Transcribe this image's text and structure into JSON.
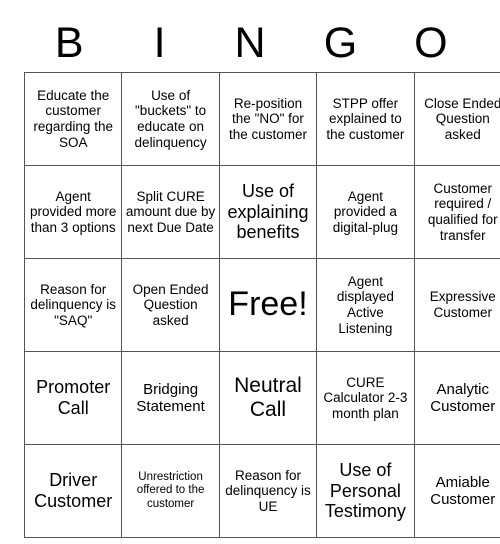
{
  "card": {
    "headers": [
      "B",
      "I",
      "N",
      "G",
      "O"
    ],
    "rows": [
      [
        {
          "text": "Educate the customer regarding the SOA",
          "size": "sz-sm"
        },
        {
          "text": "Use of \"buckets\" to educate on delinquency",
          "size": "sz-sm"
        },
        {
          "text": "Re-position the \"NO\" for the customer",
          "size": "sz-sm"
        },
        {
          "text": "STPP offer explained to the customer",
          "size": "sz-sm"
        },
        {
          "text": "Close Ended Question asked",
          "size": "sz-sm"
        }
      ],
      [
        {
          "text": "Agent provided more than 3 options",
          "size": "sz-sm"
        },
        {
          "text": "Split CURE amount due by next Due Date",
          "size": "sz-sm"
        },
        {
          "text": "Use of explaining benefits",
          "size": "sz-lg"
        },
        {
          "text": "Agent provided a digital-plug",
          "size": "sz-sm"
        },
        {
          "text": "Customer required / qualified for transfer",
          "size": "sz-sm"
        }
      ],
      [
        {
          "text": "Reason for delinquency is \"SAQ\"",
          "size": "sz-sm"
        },
        {
          "text": "Open Ended Question asked",
          "size": "sz-sm"
        },
        {
          "text": "Free!",
          "size": "sz-free"
        },
        {
          "text": "Agent displayed Active Listening",
          "size": "sz-sm"
        },
        {
          "text": "Expressive Customer",
          "size": "sz-sm"
        }
      ],
      [
        {
          "text": "Promoter Call",
          "size": "sz-lg"
        },
        {
          "text": "Bridging Statement",
          "size": "sz-md"
        },
        {
          "text": "Neutral Call",
          "size": "sz-xl"
        },
        {
          "text": "CURE Calculator 2-3 month plan",
          "size": "sz-sm"
        },
        {
          "text": "Analytic Customer",
          "size": "sz-md"
        }
      ],
      [
        {
          "text": "Driver Customer",
          "size": "sz-lg"
        },
        {
          "text": "Unrestriction offered to the customer",
          "size": "sz-xs"
        },
        {
          "text": "Reason for delinquency is UE",
          "size": "sz-sm"
        },
        {
          "text": "Use of Personal Testimony",
          "size": "sz-lg"
        },
        {
          "text": "Amiable Customer",
          "size": "sz-md"
        }
      ]
    ]
  }
}
